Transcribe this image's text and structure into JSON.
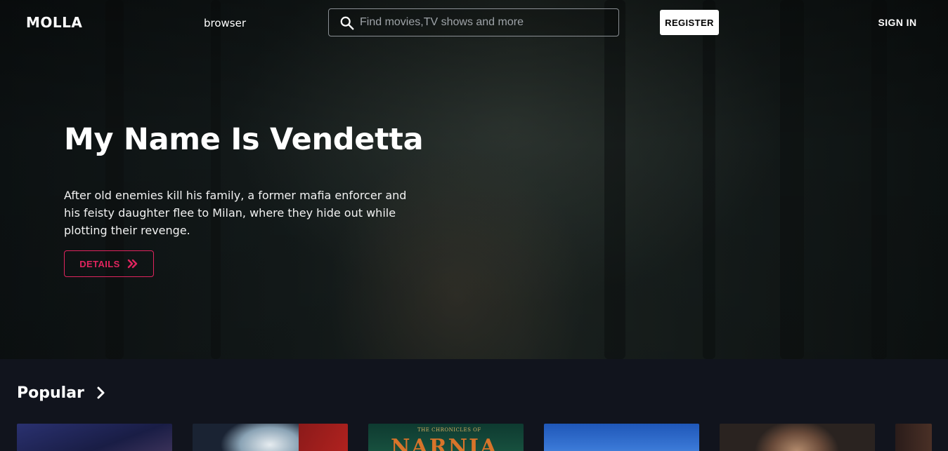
{
  "brand": {
    "logo_text": "MOLLA"
  },
  "nav": {
    "browse_label": "browser"
  },
  "search": {
    "placeholder": "Find movies,TV shows and more",
    "value": ""
  },
  "auth": {
    "register_label": "REGISTER",
    "signin_label": "SIGN IN"
  },
  "hero": {
    "title": "My Name Is Vendetta",
    "description": "After old enemies kill his family, a former mafia enforcer and his feisty daughter flee to Milan, where they hide out while plotting their revenge.",
    "details_label": "DETAILS"
  },
  "popular": {
    "title": "Popular",
    "posters": [
      {
        "title": ""
      },
      {
        "title": ""
      },
      {
        "title": "NARNIA",
        "subtitle": "THE CHRONICLES OF"
      },
      {
        "title": ""
      },
      {
        "title": ""
      },
      {
        "title": ""
      }
    ]
  },
  "colors": {
    "accent": "#e0245e",
    "background": "#11141d",
    "register_bg": "#ffffff"
  },
  "icons": {
    "search": "search-icon",
    "details": "double-chevron-right-icon",
    "popular_more": "chevron-right-icon"
  }
}
